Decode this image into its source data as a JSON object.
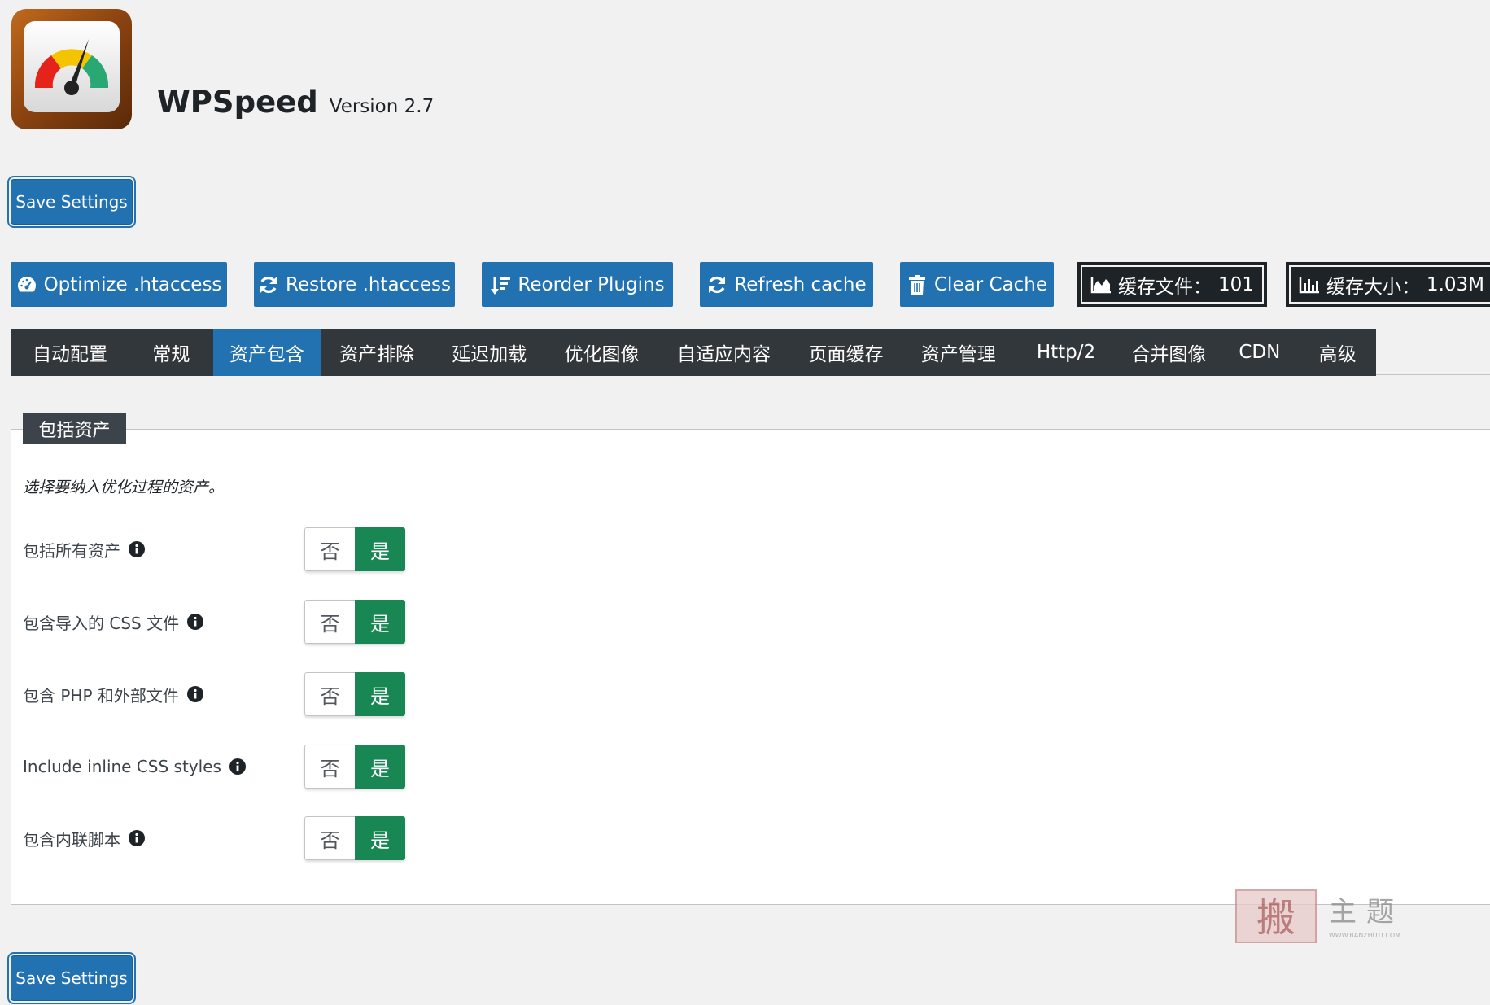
{
  "header": {
    "app_name": "WPSpeed",
    "version": "Version 2.7",
    "logo_icon": "speedometer-logo"
  },
  "save_label": "Save Settings",
  "actions": [
    {
      "label": "Optimize .htaccess",
      "icon": "dashboard-icon"
    },
    {
      "label": "Restore .htaccess",
      "icon": "refresh-icon"
    },
    {
      "label": "Reorder Plugins",
      "icon": "sort-icon"
    },
    {
      "label": "Refresh cache",
      "icon": "refresh-icon"
    },
    {
      "label": "Clear Cache",
      "icon": "trash-icon"
    }
  ],
  "stats": [
    {
      "label": "缓存文件：",
      "value": "101",
      "icon": "area-chart-icon"
    },
    {
      "label": "缓存大小：",
      "value": "1.03M",
      "icon": "bar-chart-icon"
    }
  ],
  "tabs": [
    "自动配置",
    "常规",
    "资产包含",
    "资产排除",
    "延迟加载",
    "优化图像",
    "自适应内容",
    "页面缓存",
    "资产管理",
    "Http/2",
    "合并图像",
    "CDN",
    "高级"
  ],
  "active_tab": "资产包含",
  "panel": {
    "title": "包括资产",
    "description": "选择要纳入优化过程的资产。",
    "options": [
      {
        "label": "包括所有资产",
        "no": "否",
        "yes": "是",
        "selected": "是"
      },
      {
        "label": "包含导入的 CSS 文件",
        "no": "否",
        "yes": "是",
        "selected": "是"
      },
      {
        "label": "包含 PHP 和外部文件",
        "no": "否",
        "yes": "是",
        "selected": "是"
      },
      {
        "label": "Include inline CSS styles",
        "no": "否",
        "yes": "是",
        "selected": "是"
      },
      {
        "label": "包含内联脚本",
        "no": "否",
        "yes": "是",
        "selected": "是"
      }
    ]
  },
  "watermark": {
    "text": "搬主题",
    "url_text": "WWW.BANZHUTI.COM"
  },
  "colors": {
    "primary": "#2271b1",
    "dark": "#32373c",
    "toggle_yes": "#198754",
    "background": "#f1f1f1"
  }
}
